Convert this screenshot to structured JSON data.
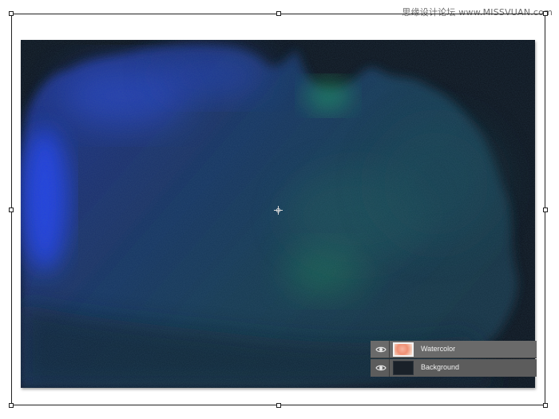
{
  "watermark": "思缘设计论坛 www.MISSVUAN.com",
  "layers": [
    {
      "name": "Watercolor",
      "visible": true,
      "thumbnail": "watercolor-thumbnail"
    },
    {
      "name": "Background",
      "visible": true,
      "thumbnail": "background-thumbnail"
    }
  ],
  "colors": {
    "canvas_bg": "#0c131c",
    "wash_blue": "#1a2f8a",
    "wash_bright_blue": "#1f3cff",
    "wash_teal": "#163a4a",
    "wash_green": "#1e7a48",
    "layer_panel": "#5c5c5c"
  }
}
